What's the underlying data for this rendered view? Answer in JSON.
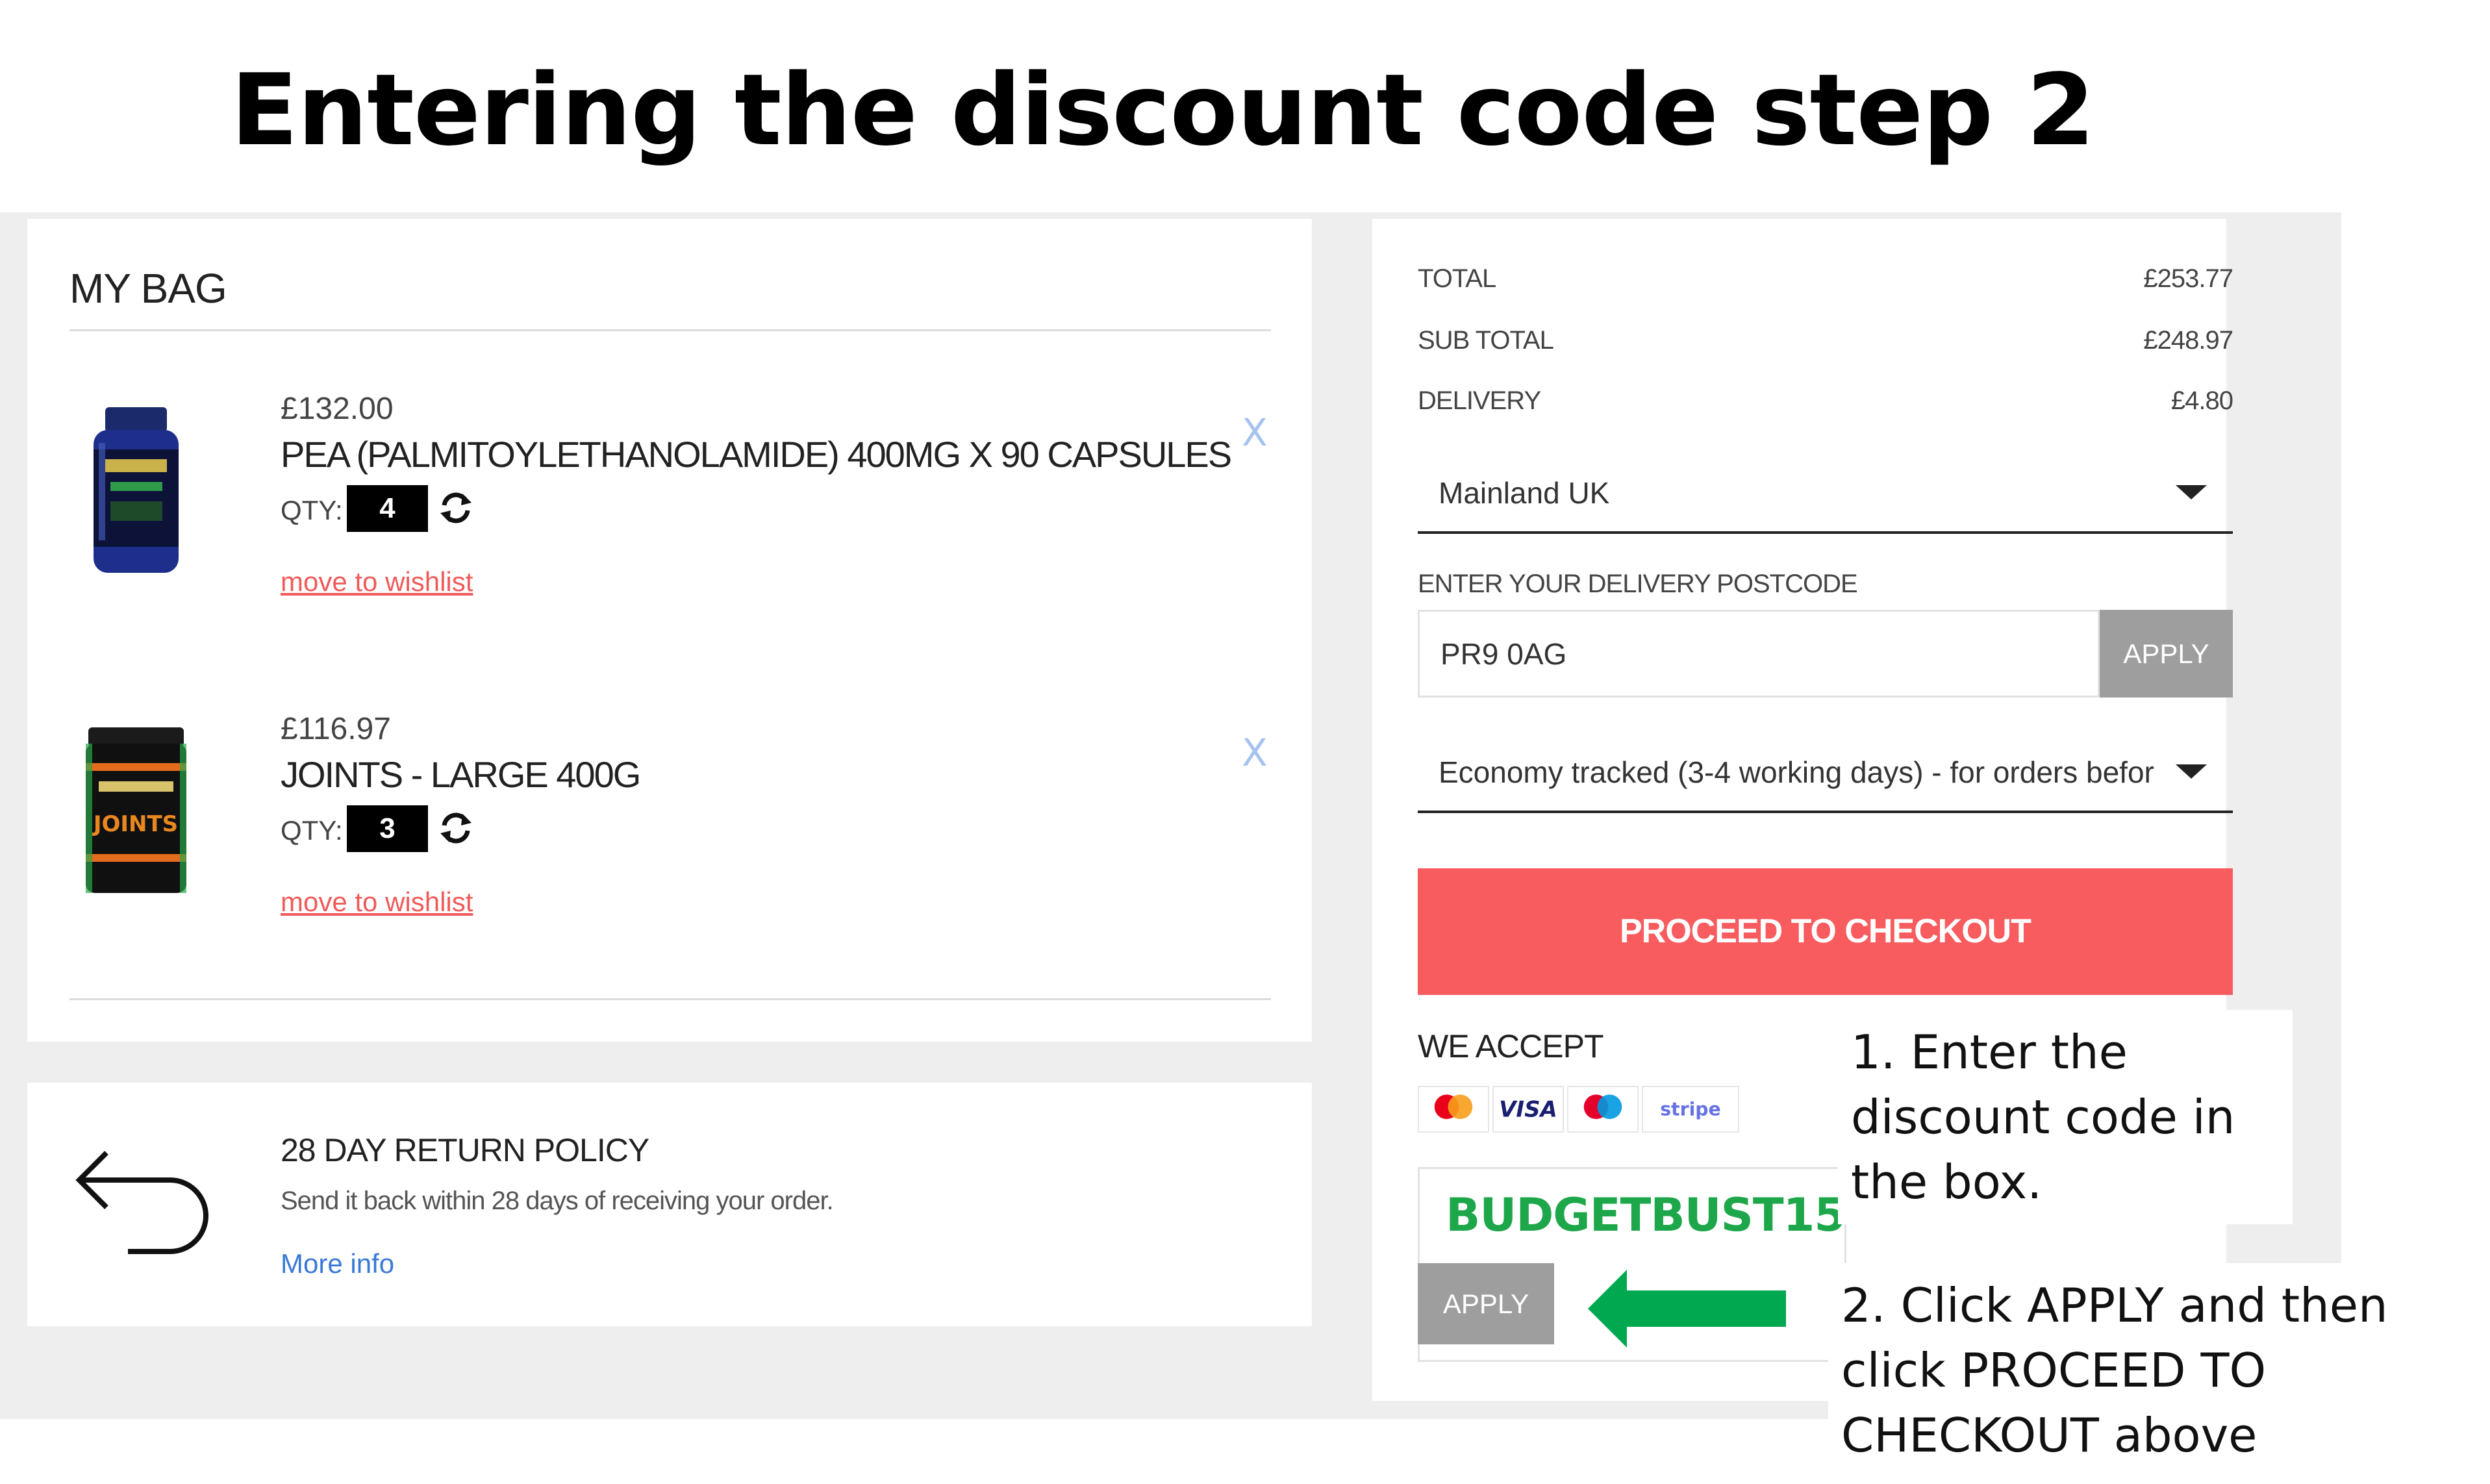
{
  "slide": {
    "title": "Entering the discount code step 2"
  },
  "bag": {
    "title": "MY BAG",
    "items": [
      {
        "price": "£132.00",
        "name": "PEA (PALMITOYLETHANOLAMIDE) 400MG X 90 CAPSULES",
        "qty_label": "QTY:",
        "qty": "4",
        "wishlist": "move to wishlist",
        "remove": "X",
        "image_icon": "supplement-bottle-icon"
      },
      {
        "price": "£116.97",
        "name": "JOINTS - LARGE 400G",
        "qty_label": "QTY:",
        "qty": "3",
        "wishlist": "move to wishlist",
        "remove": "X",
        "image_icon": "joints-tub-icon"
      }
    ]
  },
  "returns": {
    "title": "28 DAY RETURN POLICY",
    "text": "Send it back within 28 days of receiving your order.",
    "link": "More info"
  },
  "totals": {
    "total_label": "TOTAL",
    "total_value": "£253.77",
    "subtotal_label": "SUB TOTAL",
    "subtotal_value": "£248.97",
    "delivery_label": "DELIVERY",
    "delivery_value": "£4.80",
    "region": "Mainland UK",
    "postcode_label": "ENTER YOUR DELIVERY POSTCODE",
    "postcode_value": "PR9 0AG",
    "postcode_apply": "APPLY",
    "shipping_option": "Economy tracked (3-4 working days) - for orders befor",
    "checkout": "PROCEED TO CHECKOUT",
    "accept_label": "WE ACCEPT",
    "cards": [
      "mastercard-icon",
      "visa-icon",
      "maestro-icon",
      "stripe-icon"
    ],
    "visa_text": "VISA",
    "stripe_text": "stripe",
    "discount_code": "BUDGETBUST15",
    "discount_apply": "APPLY"
  },
  "annotations": {
    "step1": "1. Enter the discount code in the box.",
    "step2": "2. Click APPLY and then click PROCEED TO CHECKOUT above"
  },
  "colors": {
    "accent": "#f85c5f",
    "discount_green": "#1ea74a",
    "arrow_green": "#00a94f",
    "apply_grey": "#9e9e9e",
    "wishlist_red": "#f05a5a",
    "link_blue": "#3a78d8"
  }
}
